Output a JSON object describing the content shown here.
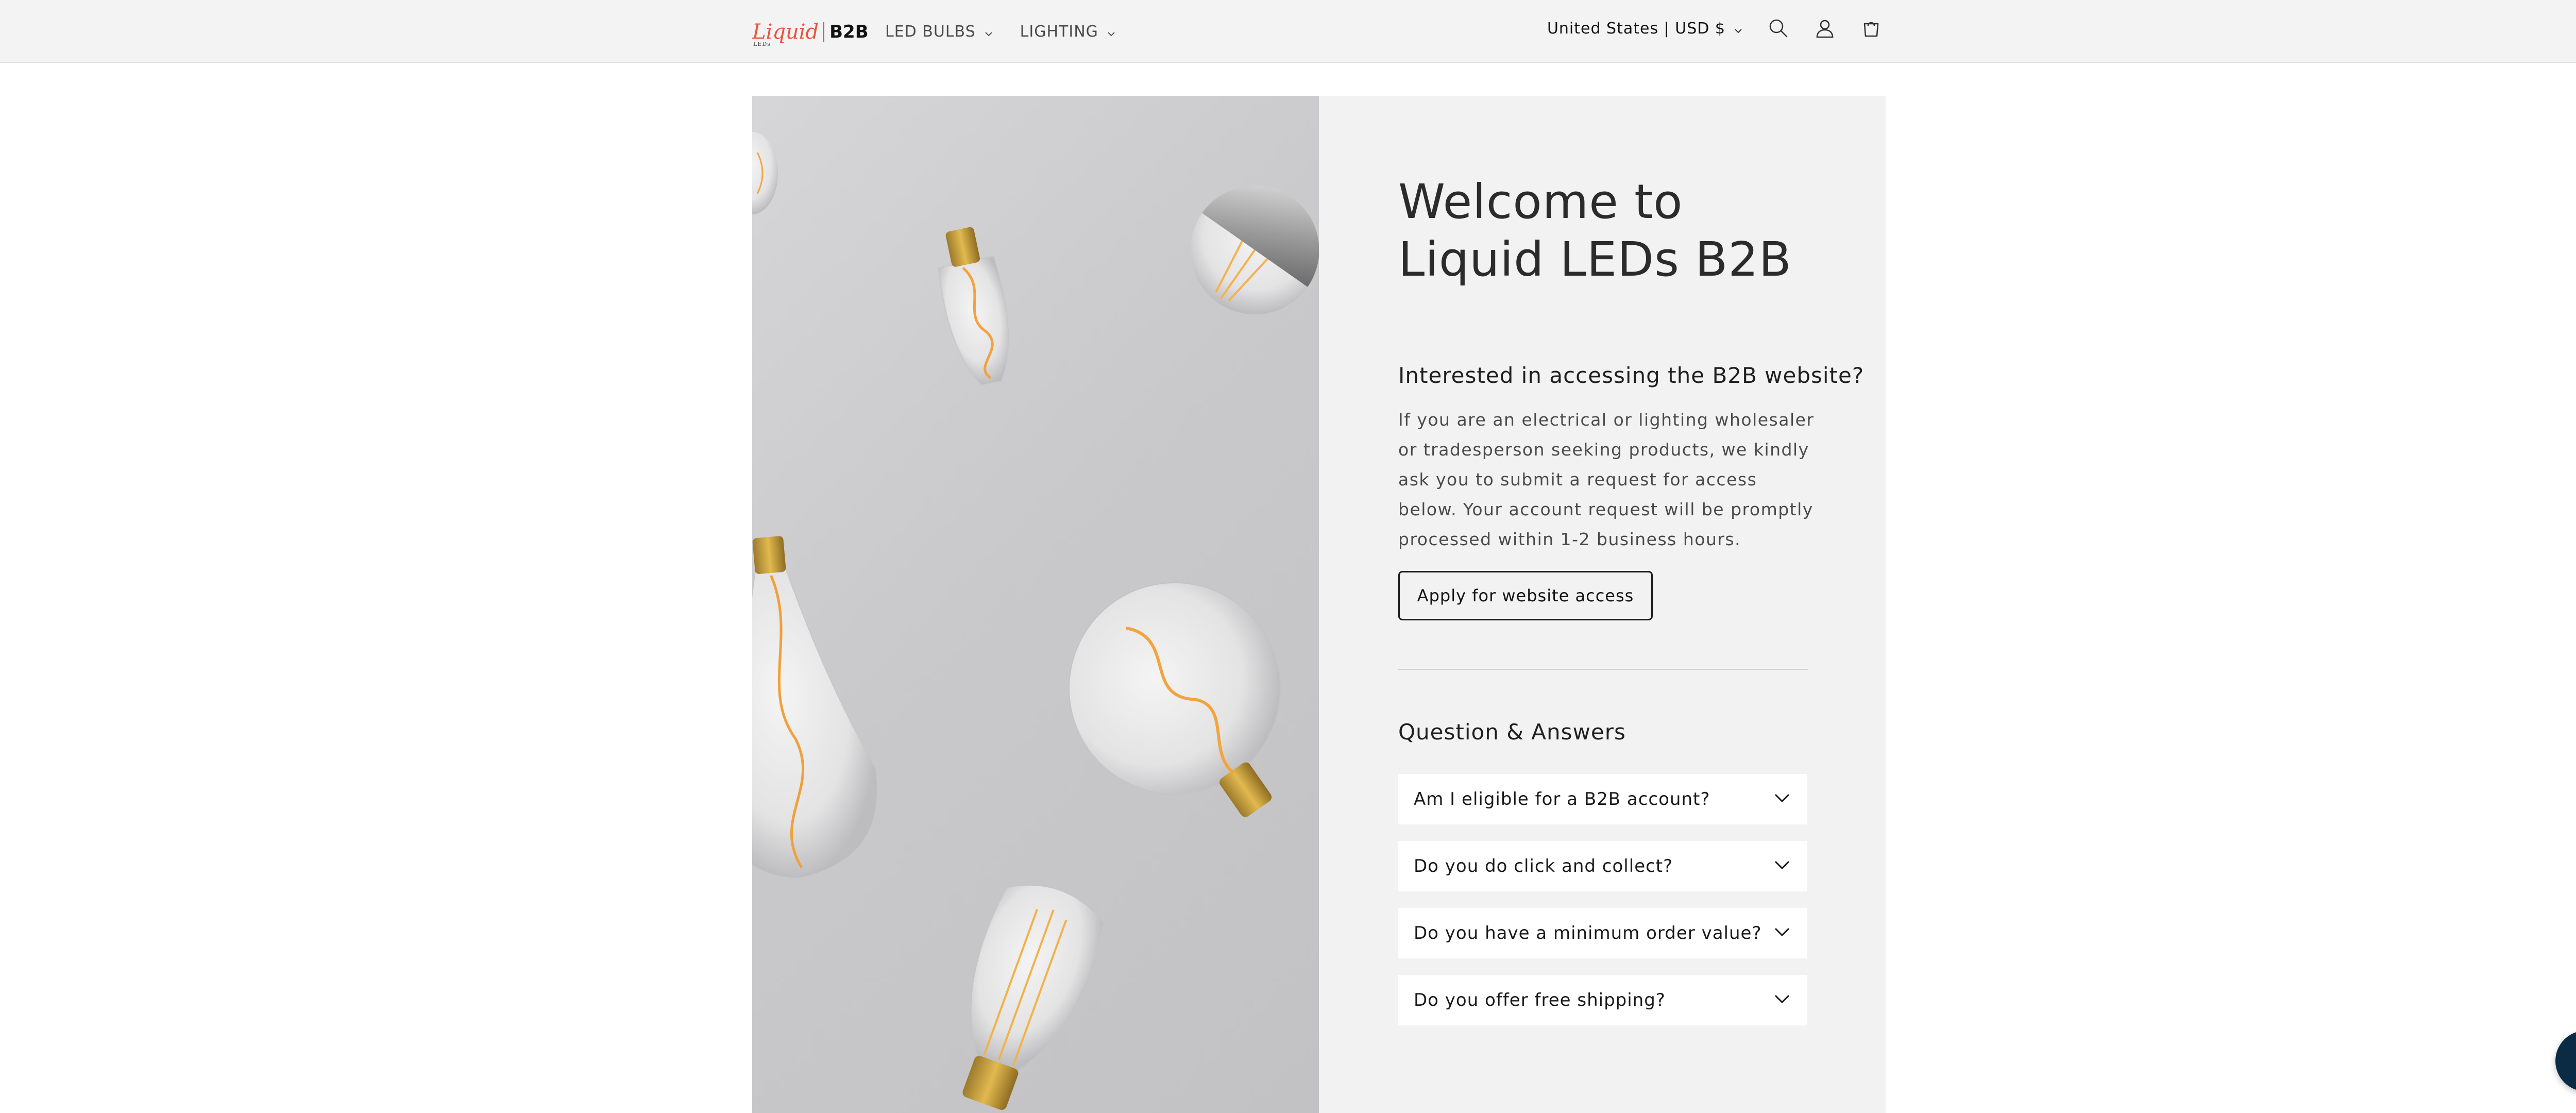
{
  "header": {
    "logo_brand": "Liquid",
    "logo_sub": "LEDs",
    "logo_b2b": "B2B",
    "nav": [
      {
        "label": "LED BULBS",
        "icon": "chevron-down-icon"
      },
      {
        "label": "LIGHTING",
        "icon": "chevron-down-icon"
      }
    ],
    "locale": "United States | USD $",
    "icons": [
      "search-icon",
      "account-icon",
      "cart-icon"
    ]
  },
  "hero": {
    "image_icon": "light-bulbs-photo"
  },
  "panel": {
    "welcome_title": "Welcome to Liquid LEDs B2B",
    "interest_title": "Interested in accessing the B2B website?",
    "interest_body": "If you are an electrical or lighting wholesaler or tradesperson seeking products, we kindly ask you to submit a request for access below. Your account request will be promptly processed within 1-2 business hours.",
    "apply_label": "Apply for website access",
    "qa_title": "Question & Answers",
    "faqs": [
      {
        "question": "Am I eligible for a B2B account?"
      },
      {
        "question": "Do you do click and collect?"
      },
      {
        "question": "Do you have a minimum order value?"
      },
      {
        "question": "Do you offer free shipping?"
      }
    ]
  },
  "help": {
    "label": "?"
  },
  "colors": {
    "brand_accent": "#e8533a",
    "help_bubble": "#0b2a43",
    "panel_bg": "#f2f2f2",
    "header_bg": "#f3f3f3"
  }
}
